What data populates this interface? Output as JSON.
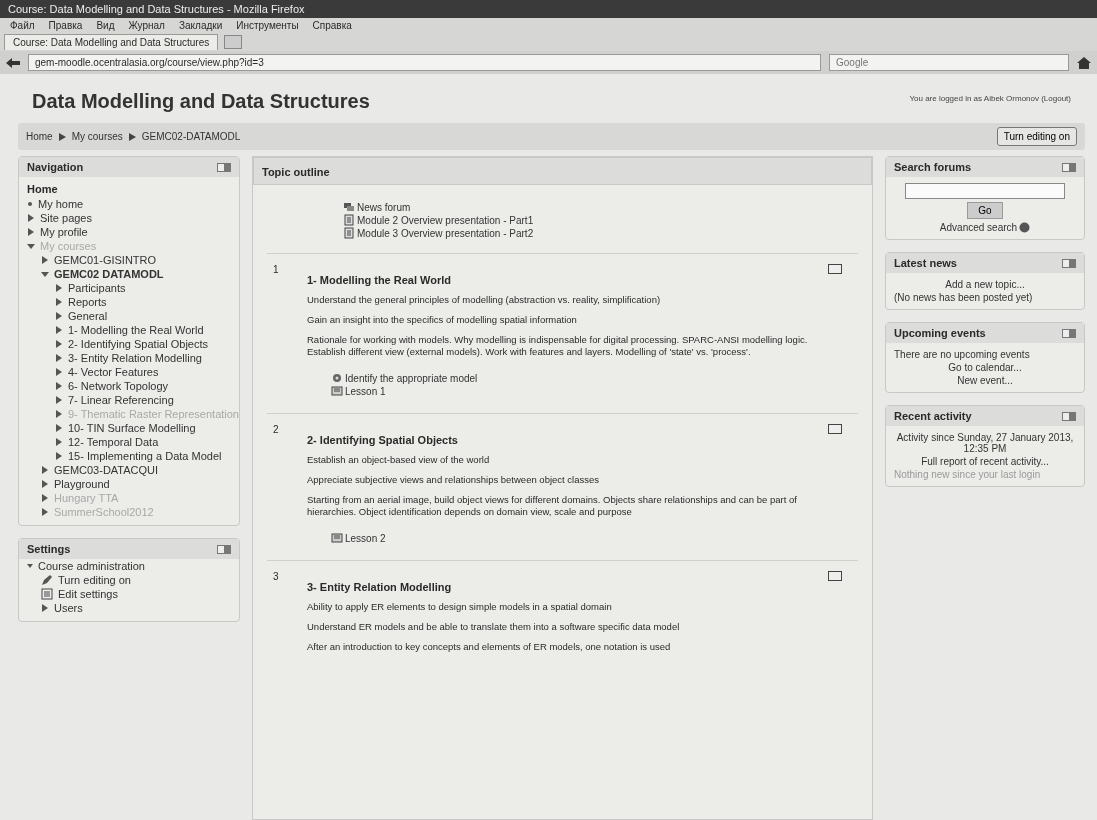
{
  "window": {
    "title": "Course: Data Modelling and Data Structures - Mozilla Firefox"
  },
  "menu": [
    "Файл",
    "Правка",
    "Вид",
    "Журнал",
    "Закладки",
    "Инструменты",
    "Справка"
  ],
  "tab": {
    "title": "Course: Data Modelling and Data Structures"
  },
  "address": {
    "url": "gem-moodle.ocentralasia.org/course/view.php?id=3"
  },
  "search": {
    "placeholder": "Google"
  },
  "page": {
    "title": "Data Modelling and Data Structures",
    "login": "You are logged in as Aibek Ormonov (Logout)",
    "breadcrumb": [
      "Home",
      "My courses",
      "GEMC02-DATAMODL"
    ],
    "edit_button": "Turn editing on"
  },
  "navigation": {
    "title": "Navigation",
    "home": "Home",
    "items": [
      {
        "label": "My home",
        "kind": "page",
        "dimmed": false
      },
      {
        "label": "Site pages",
        "kind": "node",
        "expanded": false,
        "dimmed": false
      },
      {
        "label": "My profile",
        "kind": "node",
        "expanded": false,
        "dimmed": false
      },
      {
        "label": "My courses",
        "kind": "node",
        "expanded": true,
        "dimmed": true,
        "children": [
          {
            "label": "GEMC01-GISINTRO",
            "kind": "node",
            "expanded": false,
            "dimmed": false
          },
          {
            "label": "GEMC02 DATAMODL",
            "kind": "node",
            "expanded": true,
            "dimmed": false,
            "bold": true,
            "children": [
              {
                "label": "Participants",
                "kind": "node",
                "expanded": false,
                "dimmed": false
              },
              {
                "label": "Reports",
                "kind": "node",
                "expanded": false,
                "dimmed": false
              },
              {
                "label": "General",
                "kind": "node",
                "expanded": false,
                "dimmed": false
              },
              {
                "label": "1- Modelling the Real World",
                "kind": "node",
                "expanded": false,
                "dimmed": false
              },
              {
                "label": "2- Identifying Spatial Objects",
                "kind": "node",
                "expanded": false,
                "dimmed": false
              },
              {
                "label": "3- Entity Relation Modelling",
                "kind": "node",
                "expanded": false,
                "dimmed": false
              },
              {
                "label": "4- Vector Features",
                "kind": "node",
                "expanded": false,
                "dimmed": false
              },
              {
                "label": "6- Network Topology",
                "kind": "node",
                "expanded": false,
                "dimmed": false
              },
              {
                "label": "7- Linear Referencing",
                "kind": "node",
                "expanded": false,
                "dimmed": false
              },
              {
                "label": "9- Thematic Raster Representation",
                "kind": "node",
                "expanded": false,
                "dimmed": true
              },
              {
                "label": "10- TIN Surface Modelling",
                "kind": "node",
                "expanded": false,
                "dimmed": false
              },
              {
                "label": "12- Temporal Data",
                "kind": "node",
                "expanded": false,
                "dimmed": false
              },
              {
                "label": "15- Implementing a Data Model",
                "kind": "node",
                "expanded": false,
                "dimmed": false
              }
            ]
          },
          {
            "label": "GEMC03-DATACQUI",
            "kind": "node",
            "expanded": false,
            "dimmed": false
          },
          {
            "label": "Playground",
            "kind": "node",
            "expanded": false,
            "dimmed": false
          },
          {
            "label": "Hungary TTA",
            "kind": "node",
            "expanded": false,
            "dimmed": true
          },
          {
            "label": "SummerSchool2012",
            "kind": "node",
            "expanded": false,
            "dimmed": true
          }
        ]
      }
    ]
  },
  "settings": {
    "title": "Settings",
    "items": [
      {
        "label": "Course administration",
        "kind": "page",
        "expanded": true,
        "children": [
          {
            "label": "Turn editing on",
            "kind": "pencil",
            "expanded": false
          },
          {
            "label": "Edit settings",
            "kind": "form",
            "expanded": false
          },
          {
            "label": "Users",
            "kind": "node",
            "expanded": false
          }
        ]
      }
    ]
  },
  "topic": {
    "title": "Topic outline",
    "resources": [
      {
        "label": "News forum",
        "kind": "forum"
      },
      {
        "label": "Module 2 Overview presentation - Part1",
        "kind": "file"
      },
      {
        "label": "Module 3 Overview presentation - Part2",
        "kind": "file"
      }
    ],
    "sections": [
      {
        "number": "1",
        "title": "1- Modelling the Real World",
        "paragraphs": [
          "Understand the general principles of modelling (abstraction vs. reality, simplification)",
          "Gain an insight into the specifics of modelling spatial information",
          "Rationale for working with models. Why modelling is indispensable for digital processing. SPARC-ANSI modelling logic. Establish different view (external models). Work with features and layers. Modelling of 'state' vs. 'process'."
        ],
        "resources": [
          {
            "label": "Identify the appropriate model",
            "kind": "quiz"
          },
          {
            "label": "Lesson 1",
            "kind": "lesson"
          }
        ]
      },
      {
        "number": "2",
        "title": "2- Identifying Spatial Objects",
        "paragraphs": [
          "Establish an object-based view of the world",
          "Appreciate subjective views and relationships between object classes",
          "Starting from an aerial image, build object views for different domains. Objects share relationships and can be part of hierarchies. Object identification depends on domain view, scale and purpose"
        ],
        "resources": [
          {
            "label": "Lesson 2",
            "kind": "lesson"
          }
        ]
      },
      {
        "number": "3",
        "title": "3- Entity Relation Modelling",
        "paragraphs": [
          "Ability to apply ER elements to design simple models in a spatial domain",
          "Understand ER models and be able to translate them into a software specific data model",
          "After an introduction to key concepts and elements of ER models, one notation is used"
        ]
      }
    ]
  },
  "search_forums": {
    "title": "Search forums",
    "button": "Go",
    "advanced": "Advanced search"
  },
  "latest_news": {
    "title": "Latest news",
    "add": "Add a new topic...",
    "empty": "(No news has been posted yet)"
  },
  "upcoming": {
    "title": "Upcoming events",
    "text": "There are no upcoming events",
    "links": [
      "Go to calendar...",
      "New event..."
    ]
  },
  "recent": {
    "title": "Recent activity",
    "since": "Activity since Sunday, 27 January 2013, 12:35 PM",
    "report": "Full report of recent activity...",
    "nothing": "Nothing new since your last login"
  }
}
